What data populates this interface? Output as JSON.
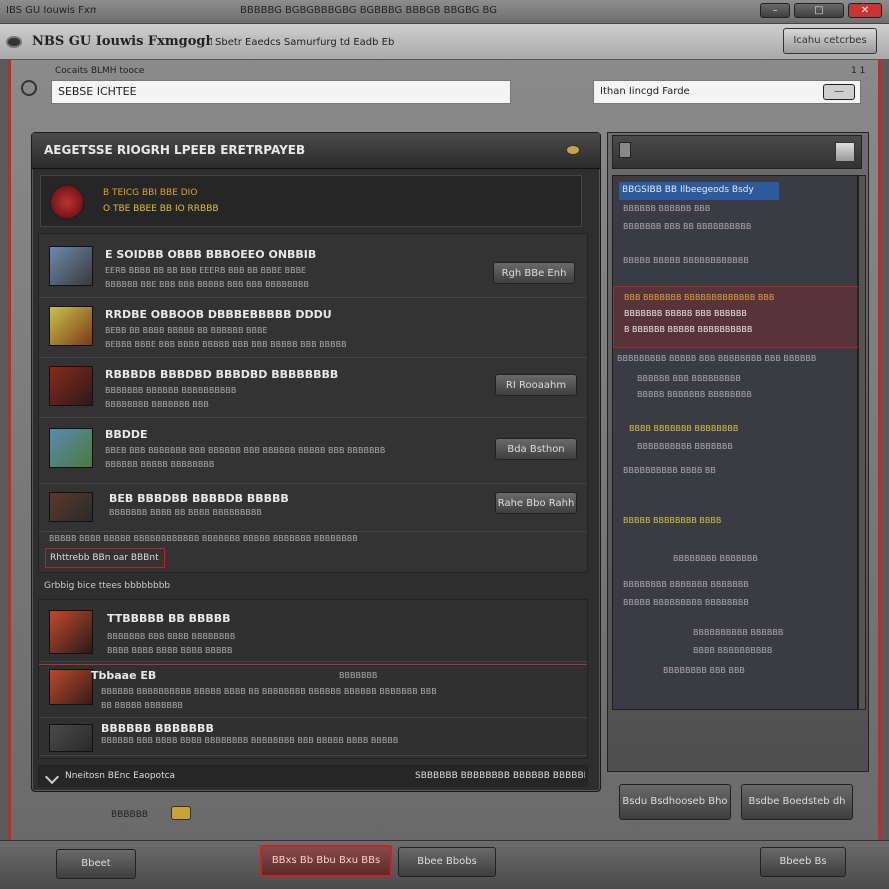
{
  "window": {
    "title": "IBS GU Iouwis Fxmgoghe",
    "title_bar_text": "BBBBBG BGBGBBBGBG BGBBBG BBBGB BBGBG BG",
    "controls": [
      "–",
      "□",
      "✕"
    ]
  },
  "menubar": {
    "app_name": "NBS GU Iouwis Fxmgoghe",
    "subtitle": "Sbetr Eaedcs Samurfurg td Eadb Eb",
    "right_button": "Icahu cetcrbes"
  },
  "address": {
    "label": "Cocaits BLMH tooce",
    "value": "SEBSE ICHTEE",
    "right_label": "1 1",
    "search_value": "Ithan Iincgd Farde",
    "search_button": "—"
  },
  "main_panel": {
    "title": "AEGETSSE RIOGRH LPEEB ERETRPAYEB",
    "header_icon": "coin-icon",
    "featured": {
      "line1": "B TEICG BBI BBE DIO",
      "line2": "O TBE BBEE BB IO  RRBBB"
    },
    "rows": [
      {
        "title": "E SOIDBB OBBB BBBOEEO ONBBIB",
        "line1": "EERB BBBB BB BB BBB EEERB BBB BB BBBE BBBE",
        "line2": "BBBBBB BBE BBB BBB BBBBB BBB BBB BBBBBBBB",
        "button": "Rgh BBe Enh"
      },
      {
        "title": "RRDBE OBBOOB DBBBEBBBBB DDDU",
        "line1": "BEBB BB BBBB BBBBB BB BBBBBB BBBE",
        "line2": "BEBBB BBBE BBB BBBB BBBBB BBB BBB BBBBB BBB BBBBB",
        "button": ""
      },
      {
        "title": "RBBBDB BBBDBD BBBDBD BBBBBBBB",
        "line1": "BBBBBBB BBBBBB BBBBBBBBBB",
        "line2": "BBBBBBBB BBBBBBB BBB",
        "button": "RI Rooaahm"
      },
      {
        "title": "BBDDE",
        "line1": "BBEB BBB BBBBBBB BBB BBBBBB BBB BBBBBB BBBBB BBB BBBBBBB",
        "line2": "BBBBBB BBBBB BBBBBBBB",
        "button": "Bda Bsthon"
      },
      {
        "title": "BEB BBBDBB BBBBDB BBBBB",
        "line1": "BBBBBBB BBBB BB BBBB BBBBBBBBB",
        "line2": "",
        "button": "Rahe Bbo Rahh"
      }
    ],
    "summary_line": "BBBBB BBBB BBBBB BBBBBBBBBBBB BBBBBBB BBBBB BBBBBBB BBBBBBBB",
    "tag_button": "Rhttrebb BBn oar BBBnt",
    "section_label": "Grbbig bice ttees  bbbbbbbb",
    "list": [
      {
        "title": "TTBBBBB BB BBBBB",
        "line1": "BBBBBBB BBB BBBB BBBBBBBB",
        "line2": "BBBB BBBB BBBB BBBB BBBBB"
      },
      {
        "title": "Tbbaae EB",
        "line1": "BBBBBB BBBBBBBBBB BBBBB BBBB BB BBBBBBBB BBBBBB BBBBBB BBBBBBB BBB",
        "line2": "BB BBBBB BBBBBBB",
        "aside": "BBBBBBB"
      },
      {
        "title": "BBBBBB BBBBBBB",
        "line1": "BBBBBB BBB BBBB BBBB BBBBBBBB BBBBBBBB BBB BBBBB BBBB BBBBB",
        "line2": ""
      }
    ],
    "footer_left": "Nneitosn BEnc Eaopotca",
    "footer_right": "SBBBBBB BBBBBBBB BBBBBB BBBBBB"
  },
  "right_panel": {
    "rows": [
      {
        "text": "BBGSIBB BB Ilbeegeods Bsdy",
        "style": "blue"
      },
      {
        "text": "BBBBBB BBBBBB BBB",
        "style": "plain"
      },
      {
        "text": "BBBBBBB BBB BB BBBBBBBBBB",
        "style": "plain"
      },
      {
        "text": "BBBBB BBBBB  BBBBBBBBBBBB",
        "style": "plain"
      },
      {
        "text": "BBB BBBBBBB BBBBBBBBBBBBB BBB",
        "style": "highlight"
      },
      {
        "text": "BBBBBBB BBBBB BBB BBBBBB",
        "style": "highlight"
      },
      {
        "text": "B BBBBBB BBBBB BBBBBBBBBB",
        "style": "highlight"
      },
      {
        "text": "BBBBBBBBB BBBBB BBB BBBBBBBB BBB BBBBBB",
        "style": "plain"
      },
      {
        "text": "BBBBBB  BBB BBBBBBBBB",
        "style": "plain"
      },
      {
        "text": "BBBBB BBBBBBB BBBBBBBB",
        "style": "plain"
      },
      {
        "text": "BBBB BBBBBBB BBBBBBBB",
        "style": "yellow"
      },
      {
        "text": "BBBBBBBBBB BBBBBBB",
        "style": "plain"
      },
      {
        "text": "BBBBBBBBBB BBBB BB",
        "style": "plain"
      },
      {
        "text": "BBBBB  BBBBBBBB BBBB",
        "style": "yellow"
      },
      {
        "text": "BBBBBBBB BBBBBBB",
        "style": "plain"
      },
      {
        "text": "BBBBBBBB BBBBBBB BBBBBBB",
        "style": "plain"
      },
      {
        "text": "BBBBB BBBBBBBBB BBBBBBBB",
        "style": "plain"
      },
      {
        "text": "BBBBBBBBBB BBBBBB",
        "style": "plain"
      },
      {
        "text": "BBBB BBBBBBBBBB",
        "style": "plain"
      },
      {
        "text": "BBBBBBBB BBB BBB",
        "style": "plain"
      }
    ],
    "button_left": "Bsdu Bsdhooseb Bho",
    "button_right": "Bsdbe Boedsteb dh"
  },
  "bottom_bar": {
    "brand_text": "BBBBBB",
    "button_1": "Bbeet",
    "button_2": "BBxs Bb Bbu Bxu BBs",
    "button_3": "Bbee Bbobs",
    "button_4": "Bbeeb Bs"
  },
  "colors": {
    "accent_red": "#c22222",
    "highlight_yellow": "#d6c23a",
    "sidebar_blue": "#2c5a9a"
  }
}
